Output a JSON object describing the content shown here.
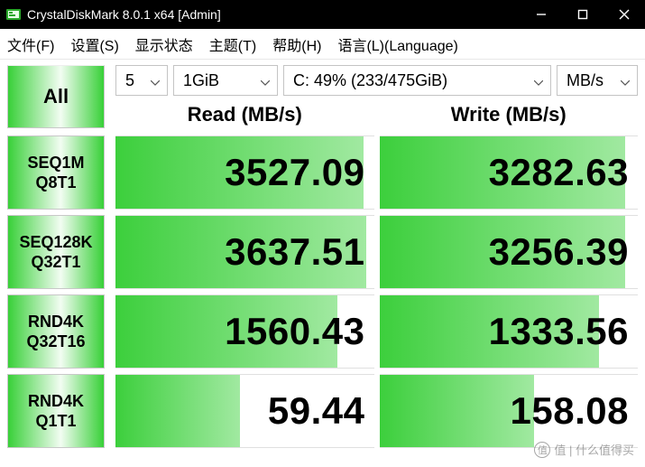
{
  "window": {
    "title": "CrystalDiskMark 8.0.1 x64 [Admin]"
  },
  "menu": {
    "file": "文件(F)",
    "settings": "设置(S)",
    "display": "显示状态",
    "theme": "主题(T)",
    "help": "帮助(H)",
    "language": "语言(L)(Language)"
  },
  "controls": {
    "all": "All",
    "count": "5",
    "size": "1GiB",
    "drive": "C: 49% (233/475GiB)",
    "unit": "MB/s"
  },
  "headers": {
    "read": "Read (MB/s)",
    "write": "Write (MB/s)"
  },
  "tests": [
    {
      "line1": "SEQ1M",
      "line2": "Q8T1",
      "read": "3527.09",
      "read_pct": 96,
      "write": "3282.63",
      "write_pct": 95
    },
    {
      "line1": "SEQ128K",
      "line2": "Q32T1",
      "read": "3637.51",
      "read_pct": 97,
      "write": "3256.39",
      "write_pct": 95
    },
    {
      "line1": "RND4K",
      "line2": "Q32T16",
      "read": "1560.43",
      "read_pct": 86,
      "write": "1333.56",
      "write_pct": 85
    },
    {
      "line1": "RND4K",
      "line2": "Q1T1",
      "read": "59.44",
      "read_pct": 48,
      "write": "158.08",
      "write_pct": 60
    }
  ],
  "watermark": "值 | 什么值得买",
  "chart_data": {
    "type": "table",
    "title": "CrystalDiskMark 8.0.1 x64 benchmark results",
    "unit": "MB/s",
    "drive": "C: 49% (233/475GiB)",
    "test_size": "1GiB",
    "test_count": 5,
    "columns": [
      "Test",
      "Read (MB/s)",
      "Write (MB/s)"
    ],
    "rows": [
      [
        "SEQ1M Q8T1",
        3527.09,
        3282.63
      ],
      [
        "SEQ128K Q32T1",
        3637.51,
        3256.39
      ],
      [
        "RND4K Q32T16",
        1560.43,
        1333.56
      ],
      [
        "RND4K Q1T1",
        59.44,
        158.08
      ]
    ]
  }
}
